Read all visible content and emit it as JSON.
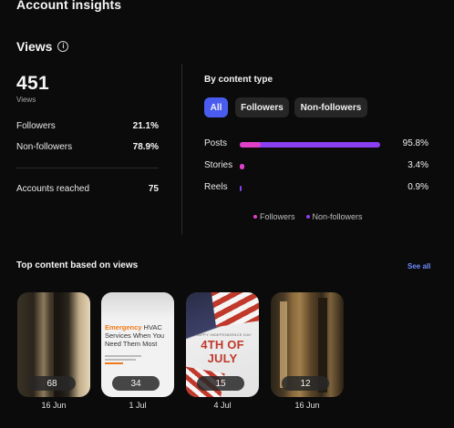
{
  "header": {
    "title": "Account insights"
  },
  "views": {
    "title": "Views",
    "total": "451",
    "total_caption": "Views",
    "followers_label": "Followers",
    "followers_value": "21.1%",
    "nonfollowers_label": "Non-followers",
    "nonfollowers_value": "78.9%",
    "reached_label": "Accounts reached",
    "reached_value": "75"
  },
  "content_type": {
    "title": "By content type",
    "chips": [
      "All",
      "Followers",
      "Non-followers"
    ],
    "active_chip": "All",
    "rows": [
      {
        "label": "Posts",
        "value": "95.8%",
        "total_pct": 95.8,
        "followers_pct": 14
      },
      {
        "label": "Stories",
        "value": "3.4%",
        "total_pct": 3.4,
        "followers_pct": 3.4
      },
      {
        "label": "Reels",
        "value": "0.9%",
        "total_pct": 0.9,
        "followers_pct": 0
      }
    ],
    "legend": [
      "Followers",
      "Non-followers"
    ],
    "colors": {
      "followers": "#e040c8",
      "non_followers": "#8a3ff0",
      "accent": "#4a5cf0",
      "link": "#6b8cff"
    }
  },
  "top_content": {
    "title": "Top content based on views",
    "see_all": "See all",
    "items": [
      {
        "count": "68",
        "date": "16 Jun"
      },
      {
        "count": "34",
        "date": "1 Jul",
        "headline_accent": "Emergency",
        "headline": "HVAC Services When You Need Them Most"
      },
      {
        "count": "15",
        "date": "4 Jul",
        "small_text": "HAPPY INDEPENDENCE DAY",
        "headline": "4TH OF JULY"
      },
      {
        "count": "12",
        "date": "16 Jun"
      }
    ]
  }
}
